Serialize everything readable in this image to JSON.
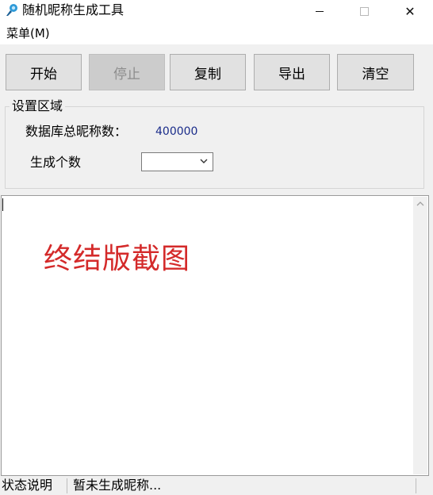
{
  "window": {
    "title": "随机昵称生成工具",
    "icon": "app-brush-icon",
    "controls": {
      "minimize": "minimize-icon",
      "maximize": "maximize-icon",
      "close": "✕"
    }
  },
  "menubar": {
    "menu_label": "菜单(M)"
  },
  "toolbar": {
    "start_label": "开始",
    "stop_label": "停止",
    "copy_label": "复制",
    "export_label": "导出",
    "clear_label": "清空"
  },
  "settings": {
    "group_title": "设置区域",
    "total_label": "数据库总昵称数：",
    "total_value": "400000",
    "count_label": "生成个数",
    "count_value": ""
  },
  "output": {
    "watermark_text": "终结版截图"
  },
  "status": {
    "label": "状态说明",
    "text": "暂未生成昵称..."
  },
  "colors": {
    "accent_value": "#1a2c8a",
    "watermark": "#d42a2a",
    "disabled_text": "#8c8c8c"
  }
}
